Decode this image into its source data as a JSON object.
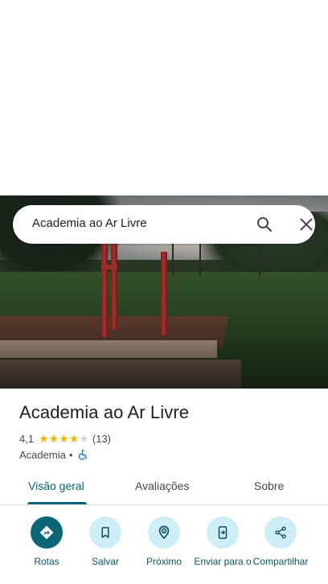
{
  "search": {
    "query": "Academia ao Ar Livre",
    "icons": {
      "search": "search-icon",
      "close": "close-icon"
    }
  },
  "place": {
    "name": "Academia ao Ar Livre",
    "rating": "4,1",
    "rating_value": 4.1,
    "stars_filled": 4,
    "review_count": "(13)",
    "category": "Academia",
    "separator": "•",
    "accessibility_icon": "wheelchair-icon"
  },
  "tabs": [
    {
      "label": "Visão geral",
      "active": true
    },
    {
      "label": "Avaliações",
      "active": false
    },
    {
      "label": "Sobre",
      "active": false
    }
  ],
  "actions": [
    {
      "label": "Rotas",
      "icon": "directions-icon"
    },
    {
      "label": "Salvar",
      "icon": "bookmark-icon"
    },
    {
      "label": "Próximo",
      "icon": "nearby-icon"
    },
    {
      "label": "Enviar para o",
      "icon": "send-to-phone-icon"
    },
    {
      "label": "Compartilhar",
      "icon": "share-icon"
    }
  ],
  "colors": {
    "accent": "#00687a",
    "action_bg": "#cdeef6",
    "action_primary": "#0b6777",
    "star": "#f4b400",
    "accessibility": "#1a73e8"
  }
}
